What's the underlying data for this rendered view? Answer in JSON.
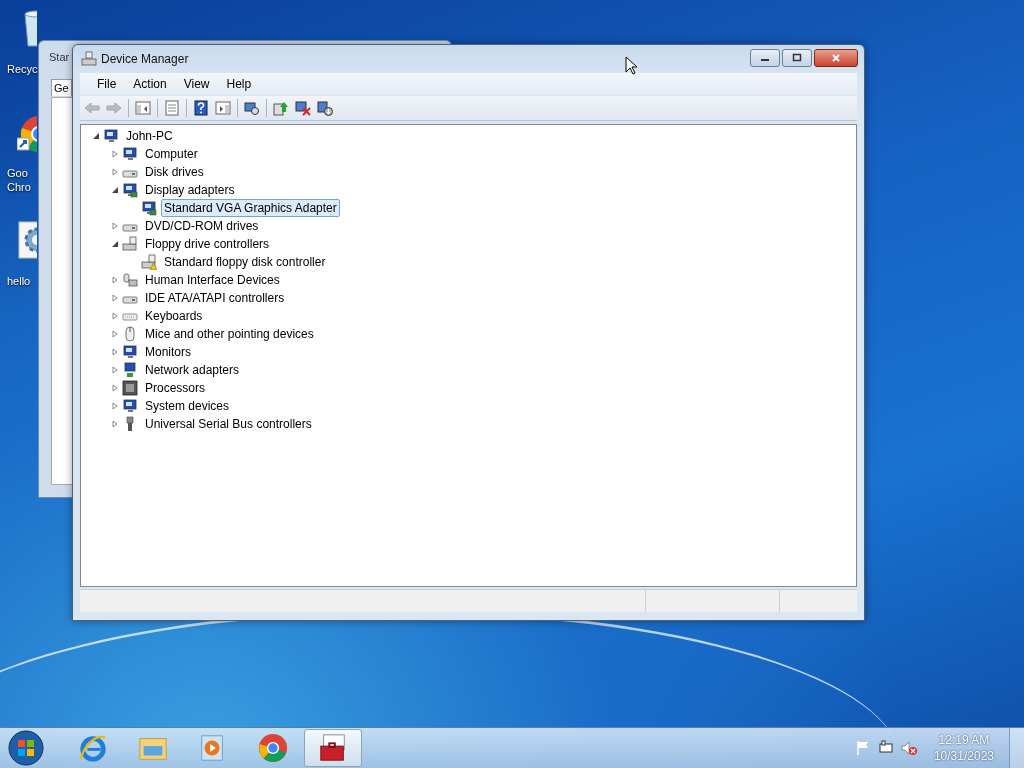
{
  "desktop_icons": [
    {
      "kind": "recycle",
      "lines": [
        "Recyc"
      ]
    },
    {
      "kind": "chrome",
      "lines": [
        "Goo",
        "Chro"
      ]
    },
    {
      "kind": "gear",
      "lines": [
        "hello"
      ]
    }
  ],
  "background_window": {
    "title": "Star",
    "tab": "Ge"
  },
  "window": {
    "title": "Device Manager"
  },
  "menu": [
    "File",
    "Action",
    "View",
    "Help"
  ],
  "toolbar": [
    {
      "kind": "back",
      "disabled": true
    },
    {
      "kind": "forward",
      "disabled": true
    },
    {
      "kind": "tree",
      "disabled": false
    },
    {
      "kind": "properties",
      "disabled": false
    },
    {
      "kind": "help",
      "disabled": false
    },
    {
      "kind": "pane",
      "disabled": false
    },
    {
      "kind": "scan",
      "disabled": false
    },
    {
      "kind": "update",
      "disabled": false
    },
    {
      "kind": "uninstall",
      "disabled": false
    },
    {
      "kind": "disable",
      "disabled": false
    }
  ],
  "tree": {
    "label": "John-PC",
    "kind": "pc",
    "expanded": true,
    "selected": false,
    "children": [
      {
        "label": "Computer",
        "kind": "monitor",
        "expanded": false,
        "selected": false
      },
      {
        "label": "Disk drives",
        "kind": "drive",
        "expanded": false,
        "selected": false
      },
      {
        "label": "Display adapters",
        "kind": "card",
        "expanded": true,
        "selected": false,
        "children": [
          {
            "label": "Standard VGA Graphics Adapter",
            "kind": "card",
            "selected": true,
            "warning": false
          }
        ]
      },
      {
        "label": "DVD/CD-ROM drives",
        "kind": "drive",
        "expanded": false,
        "selected": false
      },
      {
        "label": "Floppy drive controllers",
        "kind": "floppy",
        "expanded": true,
        "selected": false,
        "children": [
          {
            "label": "Standard floppy disk controller",
            "kind": "floppy",
            "selected": false,
            "warning": true
          }
        ]
      },
      {
        "label": "Human Interface Devices",
        "kind": "hid",
        "expanded": false,
        "selected": false
      },
      {
        "label": "IDE ATA/ATAPI controllers",
        "kind": "drive",
        "expanded": false,
        "selected": false
      },
      {
        "label": "Keyboards",
        "kind": "keyboard",
        "expanded": false,
        "selected": false
      },
      {
        "label": "Mice and other pointing devices",
        "kind": "mouse",
        "expanded": false,
        "selected": false
      },
      {
        "label": "Monitors",
        "kind": "monitor",
        "expanded": false,
        "selected": false
      },
      {
        "label": "Network adapters",
        "kind": "network",
        "expanded": false,
        "selected": false
      },
      {
        "label": "Processors",
        "kind": "chip",
        "expanded": false,
        "selected": false
      },
      {
        "label": "System devices",
        "kind": "monitor",
        "expanded": false,
        "selected": false
      },
      {
        "label": "Universal Serial Bus controllers",
        "kind": "usb",
        "expanded": false,
        "selected": false
      }
    ]
  },
  "taskbar": {
    "apps": [
      {
        "kind": "ie",
        "selected": false
      },
      {
        "kind": "folder",
        "selected": false
      },
      {
        "kind": "media",
        "selected": false
      },
      {
        "kind": "chrome",
        "selected": false
      },
      {
        "kind": "toolbox",
        "selected": true
      }
    ],
    "tray": [
      {
        "kind": "flag"
      },
      {
        "kind": "network"
      },
      {
        "kind": "volume",
        "muted": true
      }
    ],
    "time": "12:19 AM",
    "date": "10/31/2023"
  }
}
